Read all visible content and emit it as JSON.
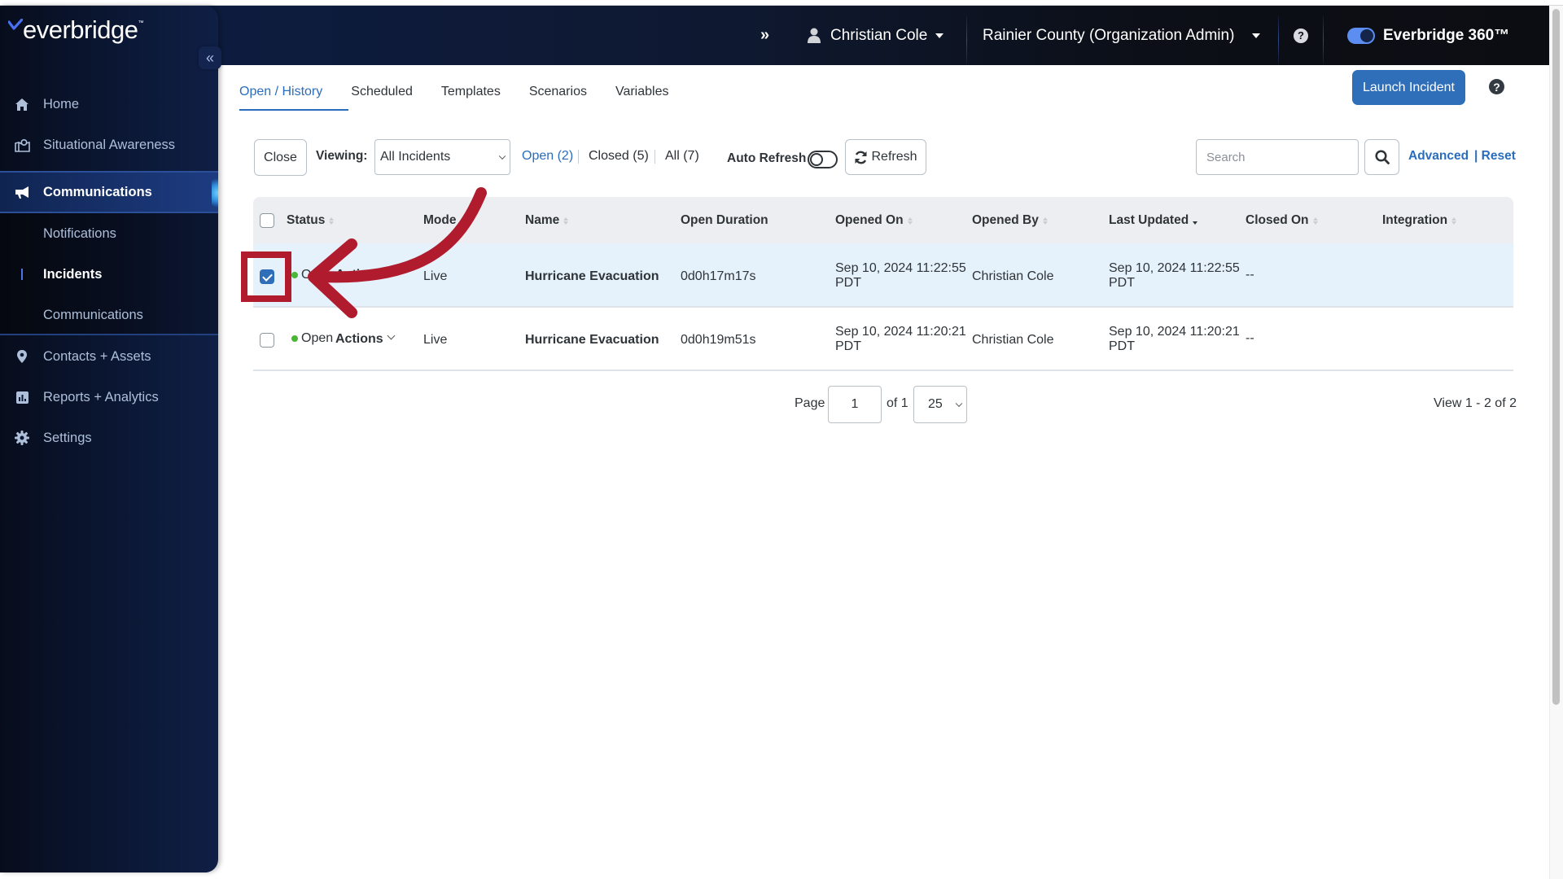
{
  "header": {
    "expand_icon": "double-chevron-right",
    "user_name": "Christian Cole",
    "organization": "Rainier County (Organization Admin)",
    "help_icon": "question-circle",
    "product_toggle_label": "Everbridge 360™",
    "product_toggle_on": true
  },
  "sidebar": {
    "logo_text": "everbridge",
    "logo_tm": "™",
    "collapse_icon": "double-chevron-left",
    "items": [
      {
        "label": "Home",
        "icon": "home-icon"
      },
      {
        "label": "Situational Awareness",
        "icon": "map-icon"
      },
      {
        "label": "Communications",
        "icon": "megaphone-icon",
        "active": true
      },
      {
        "label": "Contacts + Assets",
        "icon": "map-pin-icon"
      },
      {
        "label": "Reports + Analytics",
        "icon": "bar-chart-icon"
      },
      {
        "label": "Settings",
        "icon": "gear-icon"
      }
    ],
    "sub_items": [
      {
        "label": "Notifications"
      },
      {
        "label": "Incidents",
        "active": true
      },
      {
        "label": "Communications"
      }
    ]
  },
  "tabs": [
    {
      "label": "Open / History",
      "active": true
    },
    {
      "label": "Scheduled"
    },
    {
      "label": "Templates"
    },
    {
      "label": "Scenarios"
    },
    {
      "label": "Variables"
    }
  ],
  "launch_button": "Launch Incident",
  "toolbar": {
    "close_label": "Close",
    "viewing_label": "Viewing:",
    "viewing_value": "All Incidents",
    "filters": [
      {
        "label": "Open (2)",
        "active": true
      },
      {
        "label": "Closed (5)"
      },
      {
        "label": "All (7)"
      }
    ],
    "auto_refresh_label": "Auto Refresh",
    "auto_refresh_on": false,
    "refresh_label": "Refresh",
    "search_placeholder": "Search",
    "search_value": "",
    "advanced_label": "Advanced",
    "reset_label": "| Reset"
  },
  "table": {
    "columns": [
      "Status",
      "Mode",
      "Name",
      "Open Duration",
      "Opened On",
      "Opened By",
      "Last Updated",
      "Closed On",
      "Integration"
    ],
    "sort_column": "Last Updated",
    "sort_direction": "desc",
    "rows": [
      {
        "selected": true,
        "status": "Open",
        "actions": "Actions",
        "mode": "Live",
        "name": "Hurricane Evacuation",
        "duration": "0d0h17m17s",
        "opened_on_1": "Sep 10, 2024 11:22:55",
        "opened_on_2": "PDT",
        "opened_by": "Christian Cole",
        "updated_1": "Sep 10, 2024 11:22:55",
        "updated_2": "PDT",
        "closed_on": "--",
        "integration": ""
      },
      {
        "selected": false,
        "status": "Open",
        "actions": "Actions",
        "mode": "Live",
        "name": "Hurricane Evacuation",
        "duration": "0d0h19m51s",
        "opened_on_1": "Sep 10, 2024 11:20:21",
        "opened_on_2": "PDT",
        "opened_by": "Christian Cole",
        "updated_1": "Sep 10, 2024 11:20:21",
        "updated_2": "PDT",
        "closed_on": "--",
        "integration": ""
      }
    ]
  },
  "pagination": {
    "page_label": "Page",
    "page": "1",
    "of_label": "of 1",
    "per_page": "25",
    "summary": "View 1 - 2 of 2"
  },
  "annotation": {
    "color": "#b01c2e",
    "target": "row-1-checkbox"
  }
}
